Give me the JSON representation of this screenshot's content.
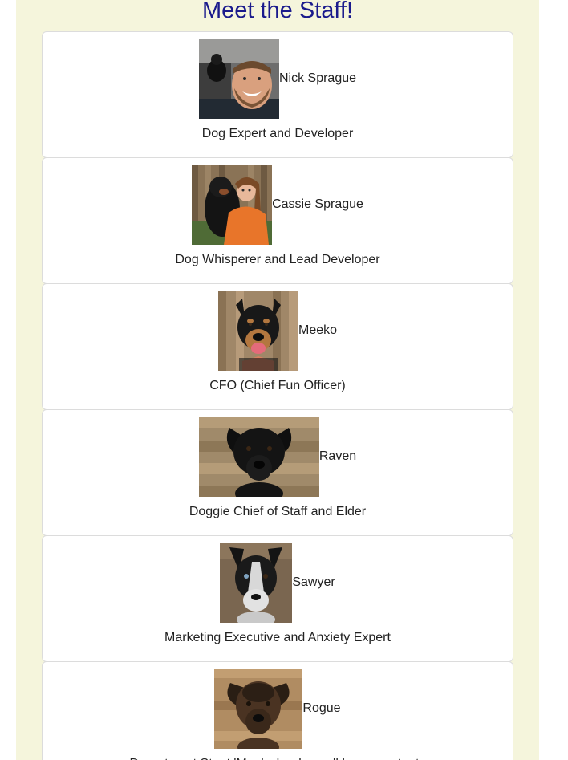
{
  "page": {
    "title": "Meet the Staff!"
  },
  "colors": {
    "panel_bg": "#f5f5dc",
    "title": "#1a1a8c",
    "card_bg": "#ffffff",
    "card_border": "#dcdcdc"
  },
  "staff": [
    {
      "name": "Nick Sprague",
      "role": "Dog Expert and Developer",
      "photo": "nick-photo"
    },
    {
      "name": "Cassie Sprague",
      "role": "Dog Whisperer and Lead Developer",
      "photo": "cassie-photo"
    },
    {
      "name": "Meeko",
      "role": "CFO (Chief Fun Officer)",
      "photo": "meeko-photo"
    },
    {
      "name": "Raven",
      "role": "Doggie Chief of Staff and Elder",
      "photo": "raven-photo"
    },
    {
      "name": "Sawyer",
      "role": "Marketing Executive and Anxiety Expert",
      "photo": "sawyer-photo"
    },
    {
      "name": "Rogue",
      "role": "Department Stunt 'Man' who does all her own stunts",
      "photo": "rogue-photo"
    }
  ]
}
